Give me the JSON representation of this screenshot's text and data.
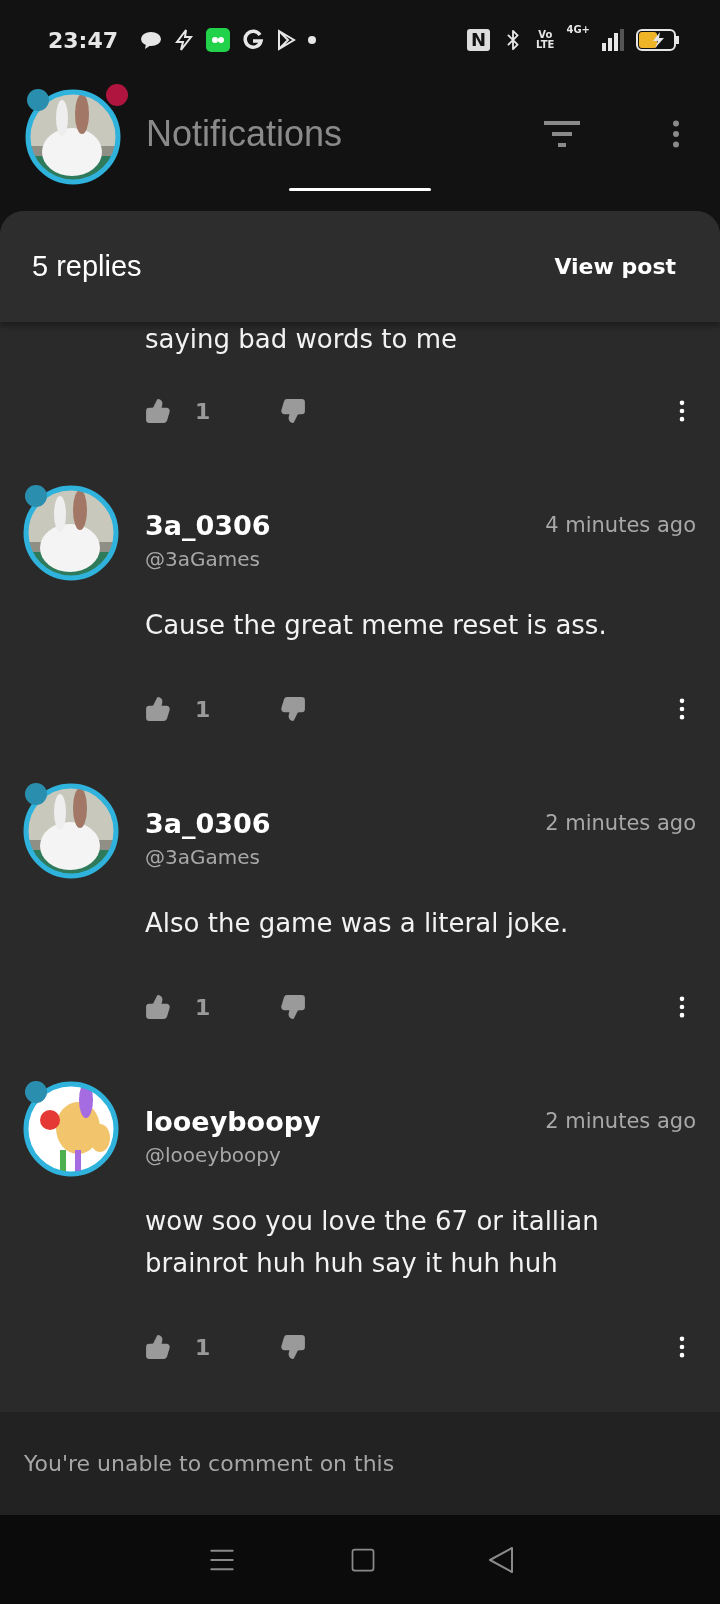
{
  "status_bar": {
    "time": "23:47",
    "nfc": "N",
    "volte": [
      "Vo",
      "LTE"
    ],
    "network": "4G+"
  },
  "header": {
    "title": "Notifications",
    "unread_dot": true
  },
  "sheet": {
    "title": "5 replies",
    "action": "View post"
  },
  "comments": [
    {
      "kind": "partial",
      "body": "saying bad words to me",
      "likes": "1"
    },
    {
      "kind": "full",
      "name": "3a_0306",
      "handle": "@3aGames",
      "time": "4 minutes ago",
      "body": "Cause the great meme reset is ass.",
      "likes": "1"
    },
    {
      "kind": "full",
      "name": "3a_0306",
      "handle": "@3aGames",
      "time": "2 minutes ago",
      "body": "Also the game was a literal joke.",
      "likes": "1"
    },
    {
      "kind": "full",
      "name": "looeyboopy",
      "handle": "@looeyboopy",
      "time": "2 minutes ago",
      "body": "wow soo you love the 67 or itallian brainrot huh huh say it huh huh",
      "likes": "1"
    }
  ],
  "footer": {
    "notice": "You're unable to comment on this"
  }
}
